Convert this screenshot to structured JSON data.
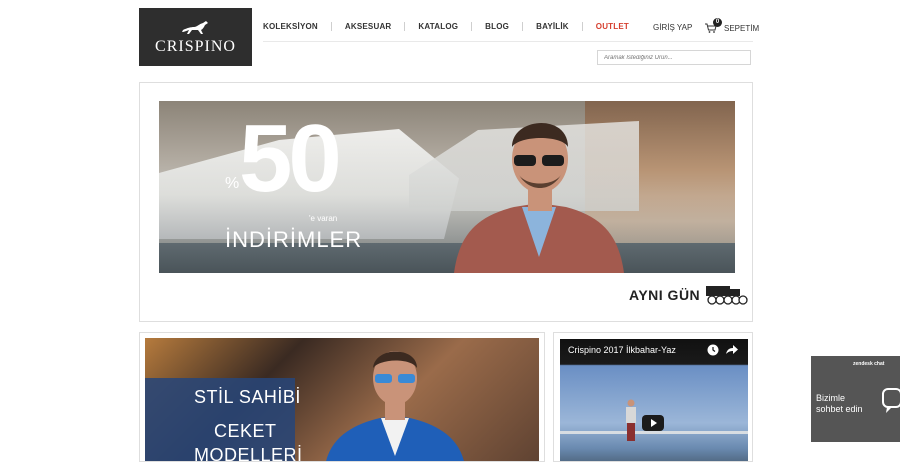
{
  "brand": {
    "name": "CRISPINO",
    "logo_icon": "horse-icon"
  },
  "nav": {
    "items": [
      {
        "label": "KOLEKSİYON",
        "highlight": false
      },
      {
        "label": "AKSESUAR",
        "highlight": false
      },
      {
        "label": "KATALOG",
        "highlight": false
      },
      {
        "label": "BLOG",
        "highlight": false
      },
      {
        "label": "BAYİLİK",
        "highlight": false
      },
      {
        "label": "OUTLET",
        "highlight": true
      }
    ]
  },
  "account": {
    "login_label": "GİRİŞ YAP",
    "cart_label": "SEPETİM",
    "cart_count": "0"
  },
  "search": {
    "placeholder": "Aramak İstediğiniz Ürün..."
  },
  "hero": {
    "percent_symbol": "%",
    "number": "50",
    "suffix": "'e varan",
    "word": "İNDİRİMLER",
    "same_day": "AYNI GÜN"
  },
  "promo2": {
    "line1": "STİL SAHİBİ",
    "line2": "CEKET",
    "line3": "MODELLERİ"
  },
  "video": {
    "title": "Crispino 2017 İlkbahar-Yaz"
  },
  "chat": {
    "brand": "zendesk chat",
    "line1": "Bizimle",
    "line2": "sohbet edin"
  },
  "colors": {
    "logo_bg": "#2e2e2e",
    "outlet": "#d64030",
    "chat_bg": "#555555"
  }
}
